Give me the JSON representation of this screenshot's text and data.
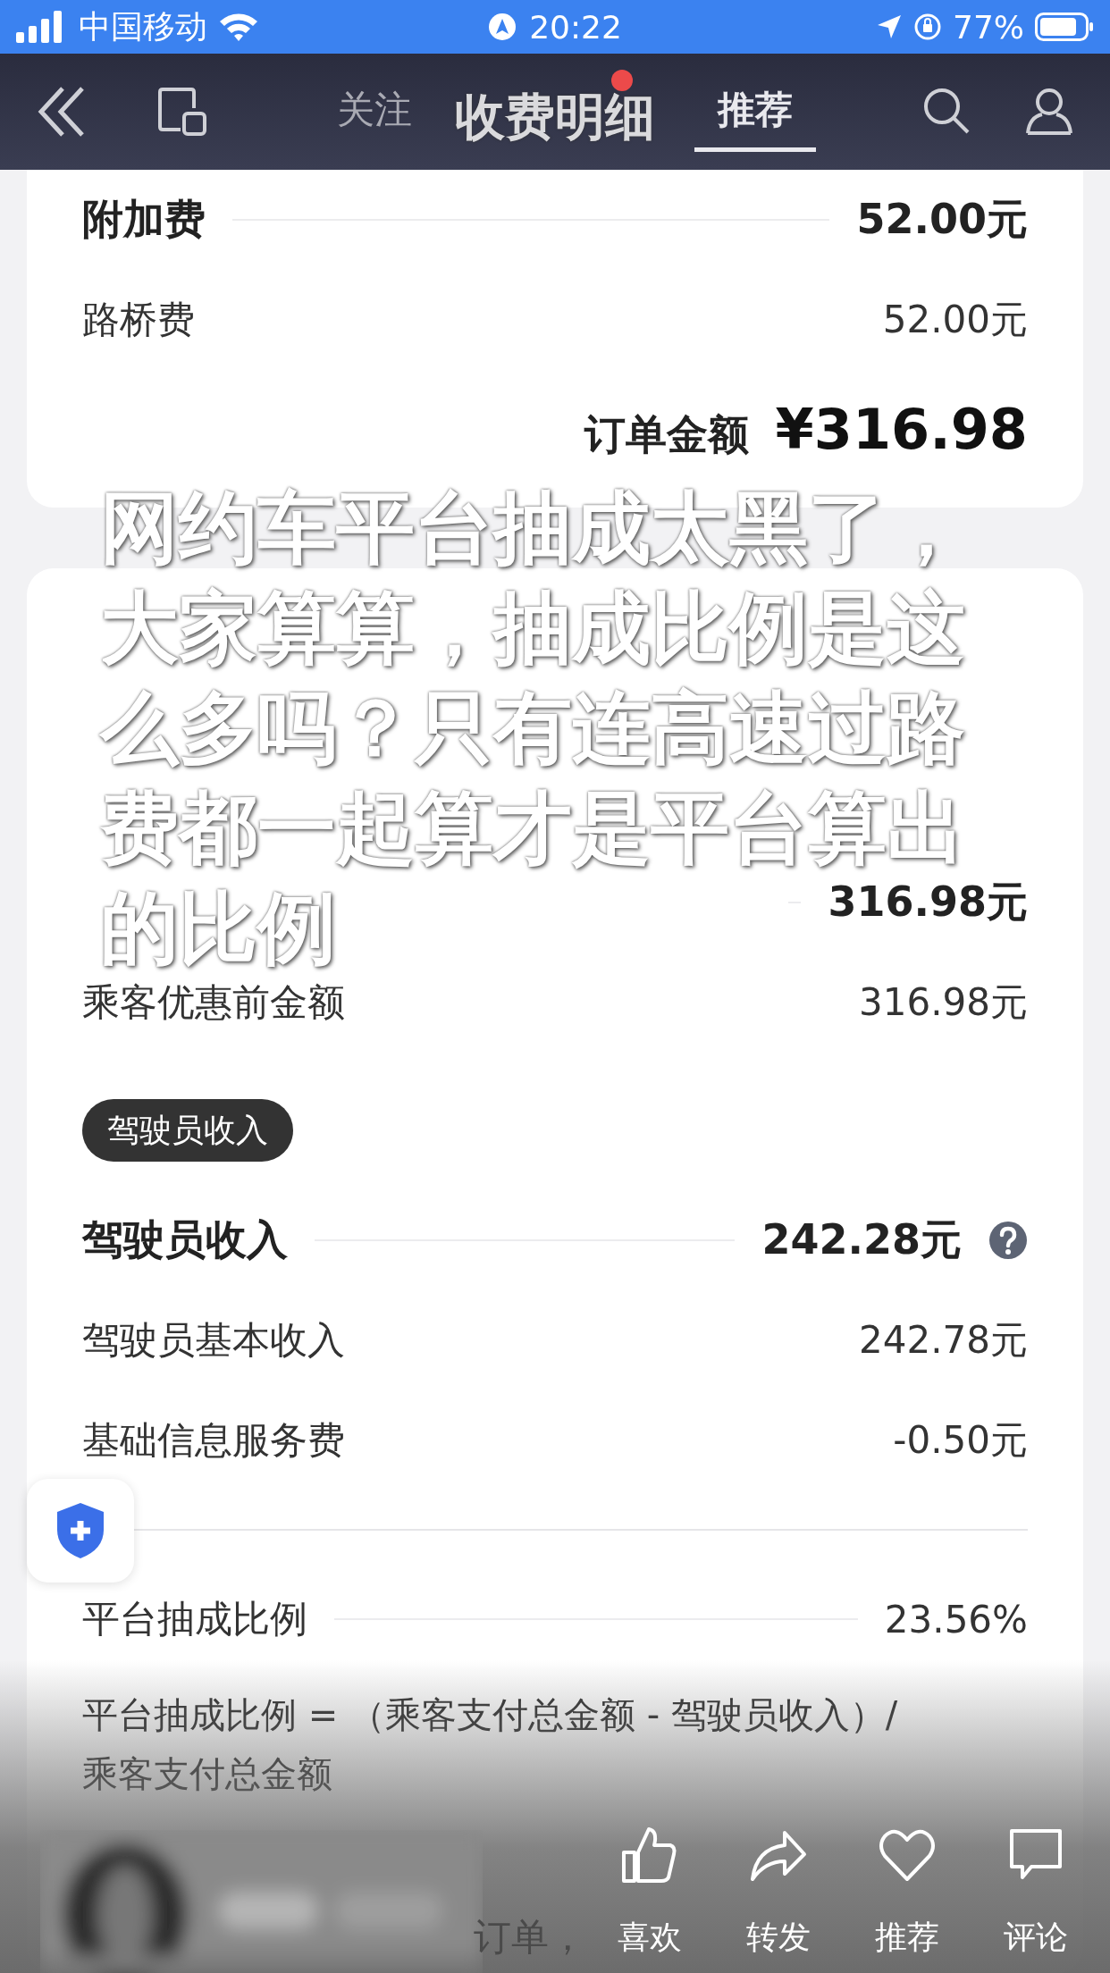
{
  "status_bar": {
    "carrier": "中国移动",
    "time": "20:22",
    "battery": "77%"
  },
  "nav": {
    "tabs": [
      {
        "label": "关注",
        "selected": false
      },
      {
        "label": "推荐",
        "selected": true
      }
    ],
    "title": "收费明细",
    "notification_dot": true
  },
  "fee_card": {
    "rows": [
      {
        "kind": "header",
        "label": "附加费",
        "value": "52.00元"
      },
      {
        "kind": "item",
        "label": "路桥费",
        "value": "52.00元"
      }
    ],
    "total_label": "订单金额",
    "total": "¥316.98"
  },
  "analysis": {
    "sections": [
      {
        "rows": [
          {
            "kind": "header",
            "value": "316.98元",
            "help": false
          },
          {
            "kind": "item",
            "label": "乘客优惠前金额",
            "value": "316.98元",
            "help": false
          }
        ]
      },
      {
        "tag": "驾驶员收入",
        "rows": [
          {
            "kind": "header",
            "label": "驾驶员收入",
            "value": "242.28元",
            "help": true
          },
          {
            "kind": "item",
            "label": "驾驶员基本收入",
            "value": "242.78元",
            "help": false
          },
          {
            "kind": "item",
            "label": "基础信息服务费",
            "value": "-0.50元",
            "help": false
          }
        ]
      }
    ],
    "ratio": {
      "label": "平台抽成比例",
      "value": "23.56%"
    },
    "formula": "平台抽成比例 = （乘客支付总金额 - 驾驶员收入）/ 乘客支付总金额"
  },
  "caption_lines": [
    "网约车平台抽成太黑了，",
    "大家算算，抽成比例是这",
    "么多吗？只有连高速过路",
    "费都一起算才是平台算出",
    "的比例"
  ],
  "description": "订单，",
  "actions": [
    {
      "kind": "like",
      "label": "喜欢"
    },
    {
      "kind": "share",
      "label": "转发"
    },
    {
      "kind": "recommend",
      "label": "推荐"
    },
    {
      "kind": "comment",
      "label": "评论"
    }
  ]
}
